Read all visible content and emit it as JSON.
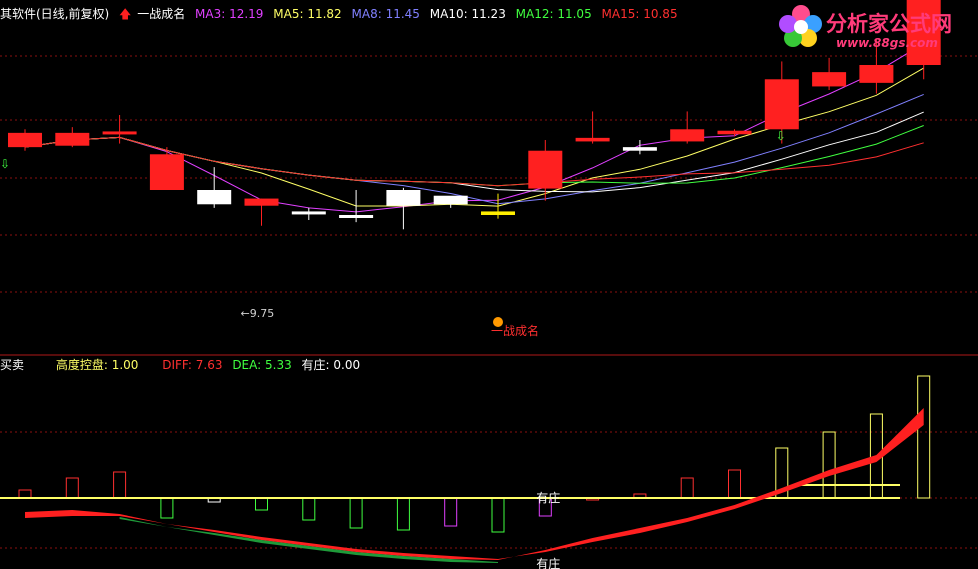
{
  "header": {
    "title": "其软件(日线,前复权)",
    "signal": "一战成名",
    "ma": [
      {
        "label": "MA3: 12.19",
        "color": "#e040ff"
      },
      {
        "label": "MA5: 11.82",
        "color": "#ffff66"
      },
      {
        "label": "MA8: 11.45",
        "color": "#8080ff"
      },
      {
        "label": "MA10: 11.23",
        "color": "#ffffff"
      },
      {
        "label": "MA12: 11.05",
        "color": "#40ff40"
      },
      {
        "label": "MA15: 10.85",
        "color": "#ff3030"
      }
    ]
  },
  "sub_header": {
    "title": "买卖",
    "items": [
      {
        "label": "高度控盘: 1.00",
        "color": "#ffff66"
      },
      {
        "label": "DIFF: 7.63",
        "color": "#ff3030"
      },
      {
        "label": "DEA: 5.33",
        "color": "#40ff40"
      },
      {
        "label": "有庄: 0.00",
        "color": "#ffffff"
      }
    ]
  },
  "logo": {
    "name": "分析家公式网",
    "url": "www.88gs.com"
  },
  "chart_data": [
    {
      "type": "candlestick",
      "price_range": [
        9.2,
        13.4
      ],
      "candles": [
        {
          "open": 12.1,
          "close": 11.9,
          "high": 12.15,
          "low": 11.85
        },
        {
          "open": 11.92,
          "close": 12.1,
          "high": 12.18,
          "low": 11.9
        },
        {
          "open": 12.12,
          "close": 12.11,
          "high": 12.35,
          "low": 11.95
        },
        {
          "open": 11.8,
          "close": 11.3,
          "high": 11.9,
          "low": 11.3
        },
        {
          "open": 11.3,
          "close": 11.1,
          "high": 11.62,
          "low": 11.05
        },
        {
          "open": 11.18,
          "close": 11.08,
          "high": 11.18,
          "low": 10.8
        },
        {
          "open": 11.0,
          "close": 10.97,
          "high": 11.05,
          "low": 10.88
        },
        {
          "open": 10.95,
          "close": 10.93,
          "high": 11.3,
          "low": 10.85
        },
        {
          "open": 11.08,
          "close": 11.3,
          "high": 11.33,
          "low": 10.75
        },
        {
          "open": 11.1,
          "close": 11.22,
          "high": 11.2,
          "low": 11.05
        },
        {
          "open": 11.0,
          "close": 10.95,
          "high": 11.25,
          "low": 10.9
        },
        {
          "open": 11.32,
          "close": 11.85,
          "high": 12.0,
          "low": 11.15
        },
        {
          "open": 11.98,
          "close": 12.03,
          "high": 12.4,
          "low": 11.95
        },
        {
          "open": 11.85,
          "close": 11.9,
          "high": 12.0,
          "low": 11.8
        },
        {
          "open": 11.98,
          "close": 12.15,
          "high": 12.4,
          "low": 11.95
        },
        {
          "open": 12.08,
          "close": 12.13,
          "high": 12.15,
          "low": 12.05
        },
        {
          "open": 12.15,
          "close": 12.85,
          "high": 13.1,
          "low": 11.95
        },
        {
          "open": 12.75,
          "close": 12.95,
          "high": 13.15,
          "low": 12.7
        },
        {
          "open": 12.8,
          "close": 13.05,
          "high": 13.4,
          "low": 12.65
        },
        {
          "open": 13.05,
          "close": 14.05,
          "high": 14.4,
          "low": 12.85
        }
      ],
      "candle_colors": [
        "red",
        "red",
        "red",
        "red",
        "white",
        "red",
        "white",
        "white",
        "white",
        "white",
        "yellow",
        "red",
        "red",
        "white",
        "red",
        "red",
        "red",
        "red",
        "red",
        "red"
      ],
      "annotations": [
        {
          "text": "←9.75",
          "index": 5
        },
        {
          "text": "一战成名",
          "index": 10
        }
      ]
    },
    {
      "type": "indicator",
      "series": [
        {
          "name": "DIFF",
          "color": "#ff3030"
        },
        {
          "name": "DEA",
          "color": "#40ff40"
        }
      ],
      "labels": [
        "有庄",
        "有庄"
      ]
    }
  ]
}
